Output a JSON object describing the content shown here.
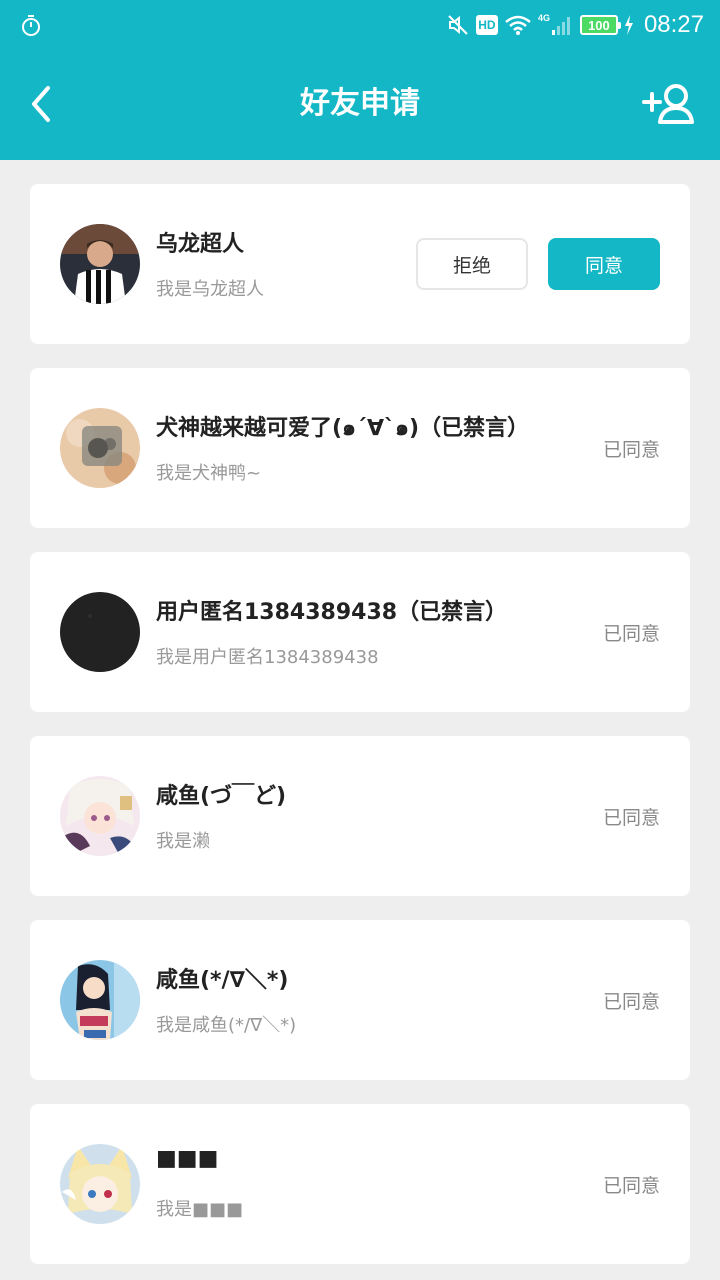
{
  "colors": {
    "accent": "#13b7c6",
    "background": "#eeeeee"
  },
  "statusbar": {
    "time": "08:27",
    "battery": "100",
    "network": "4G",
    "hd": "HD",
    "icons": [
      "timer-icon",
      "mute-icon",
      "hd-icon",
      "wifi-icon",
      "signal-icon",
      "battery-icon",
      "charging-icon"
    ]
  },
  "header": {
    "title": "好友申请",
    "back_icon": "chevron-left-icon",
    "add_icon": "add-friend-icon"
  },
  "requests": [
    {
      "name": "乌龙超人",
      "message": "我是乌龙超人",
      "reject_label": "拒绝",
      "agree_label": "同意",
      "avatar": "avatar-football-player"
    },
    {
      "name": "犬神越来越可爱了(๑´∀`๑)（已禁言）",
      "message": "我是犬神鸭~",
      "status": "已同意",
      "avatar": "avatar-anime-blur"
    },
    {
      "name": "用户匿名1384389438（已禁言）",
      "message": "我是用户匿名1384389438",
      "status": "已同意",
      "avatar": "avatar-dark"
    },
    {
      "name": "咸鱼(づ￣ど)",
      "message": "我是濑",
      "status": "已同意",
      "avatar": "avatar-anime-girl-white-hair"
    },
    {
      "name": "咸鱼(*/∇＼*)",
      "message": "我是咸鱼(*/∇＼*)",
      "status": "已同意",
      "avatar": "avatar-anime-girl-blue"
    },
    {
      "name": "■■■",
      "message": "我是■■■",
      "status": "已同意",
      "avatar": "avatar-anime-fox-girl"
    }
  ]
}
